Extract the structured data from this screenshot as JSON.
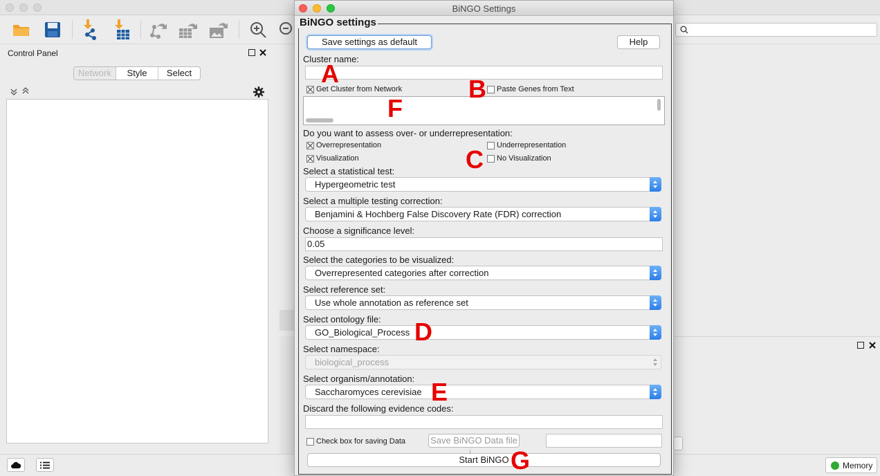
{
  "background": {
    "control_panel_title": "Control Panel",
    "tabs": [
      "Network",
      "Style",
      "Select"
    ],
    "memory_label": "Memory"
  },
  "dialog": {
    "window_title": "BiNGO Settings",
    "group_title": "BiNGO settings",
    "save_default_label": "Save settings as default",
    "help_label": "Help",
    "cluster_name_label": "Cluster name:",
    "cluster_name_value": "",
    "get_cluster_label": "Get Cluster from Network",
    "get_cluster_checked": true,
    "paste_genes_label": "Paste Genes from Text",
    "paste_genes_checked": false,
    "assess_label": "Do you want to assess over- or underrepresentation:",
    "over_label": "Overrepresentation",
    "over_checked": true,
    "under_label": "Underrepresentation",
    "under_checked": false,
    "vis_label": "Visualization",
    "vis_checked": true,
    "novis_label": "No Visualization",
    "novis_checked": false,
    "stat_test_label": "Select a statistical test:",
    "stat_test_value": "Hypergeometric test",
    "correction_label": "Select a multiple testing correction:",
    "correction_value": "Benjamini & Hochberg False Discovery Rate (FDR) correction",
    "significance_label": "Choose a significance level:",
    "significance_value": "0.05",
    "categories_label": "Select the categories to be visualized:",
    "categories_value": "Overrepresented categories after correction",
    "reference_label": "Select reference set:",
    "reference_value": "Use whole annotation as reference set",
    "ontology_label": "Select ontology file:",
    "ontology_value": "GO_Biological_Process",
    "namespace_label": "Select namespace:",
    "namespace_value": "biological_process",
    "organism_label": "Select organism/annotation:",
    "organism_value": "Saccharomyces cerevisiae",
    "evidence_label": "Discard the following evidence codes:",
    "evidence_value": "",
    "save_data_label": "Check box for saving Data",
    "save_data_checked": false,
    "save_file_label": "Save BiNGO Data file i...",
    "save_file_value": "",
    "start_label": "Start BiNGO"
  },
  "annotations": {
    "a": "A",
    "b": "B",
    "c": "C",
    "d": "D",
    "e": "E",
    "f": "F",
    "g": "G"
  },
  "colors": {
    "annotation_red": "#e60000",
    "select_arrow_blue": "#2d7ee9",
    "memory_green": "#2eaa35"
  }
}
